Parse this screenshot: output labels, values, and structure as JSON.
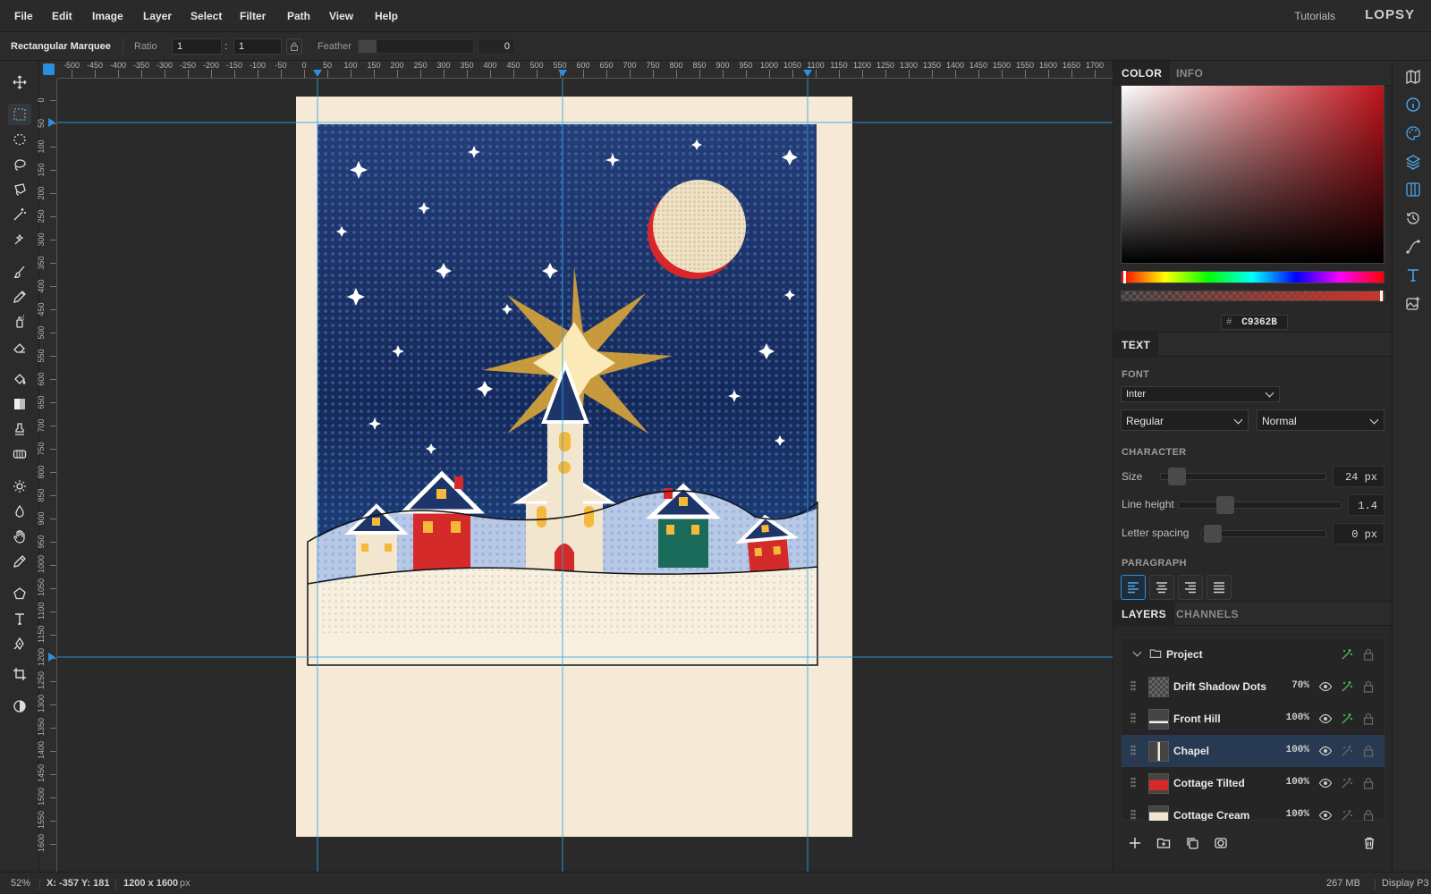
{
  "menu": {
    "items": [
      "File",
      "Edit",
      "Image",
      "Layer",
      "Select",
      "Filter",
      "Path",
      "View",
      "Help"
    ],
    "tutorials": "Tutorials",
    "logo": "LOPSY"
  },
  "options": {
    "tool_name": "Rectangular Marquee",
    "ratio_label": "Ratio",
    "ratio_w": "1",
    "ratio_sep": ":",
    "ratio_h": "1",
    "feather_label": "Feather",
    "feather_value": "0"
  },
  "tools": [
    "move-icon",
    "rect-marquee-icon",
    "ellipse-marquee-icon",
    "lasso-icon",
    "polygon-lasso-icon",
    "magic-wand-icon",
    "quick-select-icon",
    "brush-icon",
    "pencil-icon",
    "spray-icon",
    "eraser-icon",
    "fill-bucket-icon",
    "gradient-icon",
    "stamp-icon",
    "patch-icon",
    "dodge-icon",
    "blur-drop-icon",
    "hand-icon",
    "eyedropper-icon",
    "polygon-shape-icon",
    "text-tool-icon",
    "pen-tool-icon",
    "crop-icon",
    "contrast-icon"
  ],
  "ruler": {
    "h_ticks": [
      "-500",
      "-450",
      "-400",
      "-350",
      "-300",
      "-250",
      "-200",
      "-150",
      "-100",
      "-50",
      "0",
      "50",
      "100",
      "150",
      "200",
      "250",
      "300",
      "350",
      "400",
      "450",
      "500",
      "550",
      "600",
      "650",
      "700",
      "750",
      "800",
      "850",
      "900",
      "950",
      "1000",
      "1050",
      "1100",
      "1150",
      "1200",
      "1250",
      "1300",
      "1350",
      "1400",
      "1450",
      "1500",
      "1550",
      "1600",
      "1650",
      "1700"
    ],
    "v_ticks": [
      "0",
      "50",
      "100",
      "150",
      "200",
      "250",
      "300",
      "350",
      "400",
      "450",
      "500",
      "550",
      "600",
      "650",
      "700",
      "750",
      "800",
      "850",
      "900",
      "950",
      "1000",
      "1050",
      "1100",
      "1150",
      "1200",
      "1250",
      "1300",
      "1350",
      "1400",
      "1450",
      "1500",
      "1550",
      "1600",
      "50"
    ]
  },
  "color_panel": {
    "tabs": [
      "COLOR",
      "INFO"
    ],
    "hex_prefix": "#",
    "hex": "C9362B",
    "selected_color": "#C9362B"
  },
  "text_panel": {
    "tab": "TEXT",
    "font_label": "FONT",
    "font": "Inter",
    "weight": "Regular",
    "style": "Normal",
    "character_label": "CHARACTER",
    "size_label": "Size",
    "size_value": "24 px",
    "line_height_label": "Line height",
    "line_height_value": "1.4",
    "letter_spacing_label": "Letter spacing",
    "letter_spacing_value": "0 px",
    "paragraph_label": "PARAGRAPH",
    "alignments": [
      "align-left-icon",
      "align-center-icon",
      "align-right-icon",
      "align-justify-icon"
    ]
  },
  "layers_panel": {
    "tabs": [
      "LAYERS",
      "CHANNELS"
    ],
    "group_name": "Project",
    "layers": [
      {
        "name": "Drift Shadow Dots",
        "opacity": "70%"
      },
      {
        "name": "Front Hill",
        "opacity": "100%"
      },
      {
        "name": "Chapel",
        "opacity": "100%"
      },
      {
        "name": "Cottage Tilted",
        "opacity": "100%"
      },
      {
        "name": "Cottage Cream",
        "opacity": "100%"
      }
    ]
  },
  "status": {
    "zoom": "52%",
    "coords": "X: -357 Y: 181",
    "doc_size": "1200 x 1600",
    "doc_unit": "px",
    "memory": "267 MB",
    "profile": "Display P3"
  },
  "colors": {
    "accent": "#2a8fe0",
    "paper": "#f6ead6",
    "sky": "#1d3569",
    "gold": "#d9a53a",
    "red": "#d42a2a",
    "green": "#1b6b5a"
  }
}
